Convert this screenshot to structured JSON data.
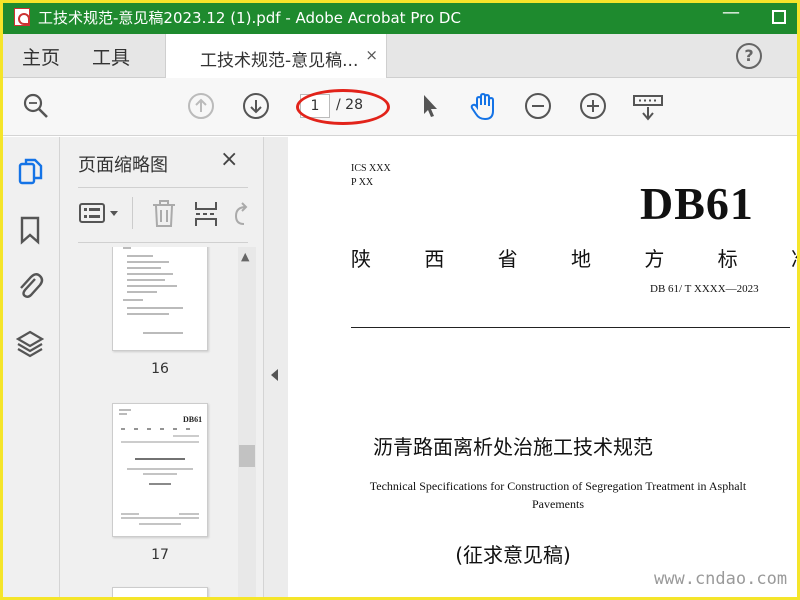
{
  "window": {
    "title": "工技术规范-意见稿2023.12 (1).pdf - Adobe Acrobat Pro DC"
  },
  "menu": {
    "home": "主页",
    "tools": "工具"
  },
  "tab": {
    "label": "工技术规范-意见稿...",
    "close": "×"
  },
  "toolbar": {
    "current_page": "1",
    "total_pages": "/ 28"
  },
  "panel": {
    "title": "页面缩略图",
    "close": "×"
  },
  "thumbnails": [
    {
      "page": "16"
    },
    {
      "page": "17"
    }
  ],
  "document": {
    "ics": "ICS XXX",
    "p": "P XX",
    "standard_code": "DB61",
    "province": [
      "陕",
      "西",
      "省",
      "地",
      "方",
      "标",
      "准"
    ],
    "std_number": "DB 61/ T XXXX—2023",
    "title_cn": "沥青路面离析处治施工技术规范",
    "title_en": "Technical Specifications for Construction of Segregation Treatment in Asphalt Pavements",
    "draft": "(征求意见稿)"
  },
  "watermark": "www.cndao.com",
  "colors": {
    "titlebar": "#1e8a2e",
    "hand_tool_active": "#1473e6",
    "annotation_ellipse": "#e2231a"
  }
}
